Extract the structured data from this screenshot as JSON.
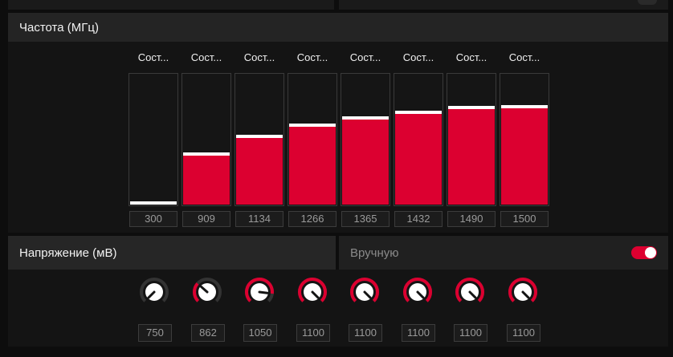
{
  "frequency": {
    "title": "Частота (МГц)",
    "states": [
      {
        "label": "Сост...",
        "value": "300",
        "level": 0.0
      },
      {
        "label": "Сост...",
        "value": "909",
        "level": 0.375
      },
      {
        "label": "Сост...",
        "value": "1134",
        "level": 0.514
      },
      {
        "label": "Сост...",
        "value": "1266",
        "level": 0.596
      },
      {
        "label": "Сост...",
        "value": "1365",
        "level": 0.657
      },
      {
        "label": "Сост...",
        "value": "1432",
        "level": 0.698
      },
      {
        "label": "Сост...",
        "value": "1490",
        "level": 0.734
      },
      {
        "label": "Сост...",
        "value": "1500",
        "level": 0.741
      }
    ]
  },
  "voltage": {
    "title": "Напряжение (мВ)",
    "manual_label": "Вручную",
    "manual_enabled": true,
    "states": [
      {
        "value": "750",
        "level": 0.0
      },
      {
        "value": "862",
        "level": 0.32
      },
      {
        "value": "1050",
        "level": 0.86
      },
      {
        "value": "1100",
        "level": 1.0
      },
      {
        "value": "1100",
        "level": 1.0
      },
      {
        "value": "1100",
        "level": 1.0
      },
      {
        "value": "1100",
        "level": 1.0
      },
      {
        "value": "1100",
        "level": 1.0
      }
    ]
  },
  "colors": {
    "accent": "#dc0030",
    "panel": "#141414",
    "header": "#242424"
  }
}
